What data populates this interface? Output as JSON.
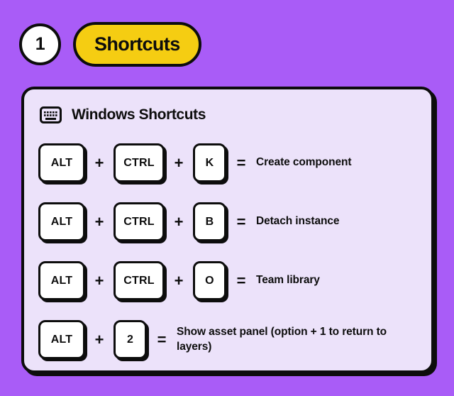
{
  "header": {
    "step_number": "1",
    "title": "Shortcuts"
  },
  "card": {
    "icon": "keyboard-icon",
    "title": "Windows Shortcuts",
    "operators": {
      "plus": "+",
      "equals": "="
    },
    "rows": [
      {
        "keys": [
          "ALT",
          "CTRL",
          "K"
        ],
        "description": "Create component"
      },
      {
        "keys": [
          "ALT",
          "CTRL",
          "B"
        ],
        "description": "Detach instance"
      },
      {
        "keys": [
          "ALT",
          "CTRL",
          "O"
        ],
        "description": "Team library"
      },
      {
        "keys": [
          "ALT",
          "2"
        ],
        "description": "Show asset panel (option + 1 to return to layers)"
      }
    ]
  },
  "colors": {
    "background": "#A95CF7",
    "card_background": "#ECE2FA",
    "accent_yellow": "#F5CD12",
    "ink": "#0D0D0D",
    "key_face": "#FFFFFF"
  }
}
